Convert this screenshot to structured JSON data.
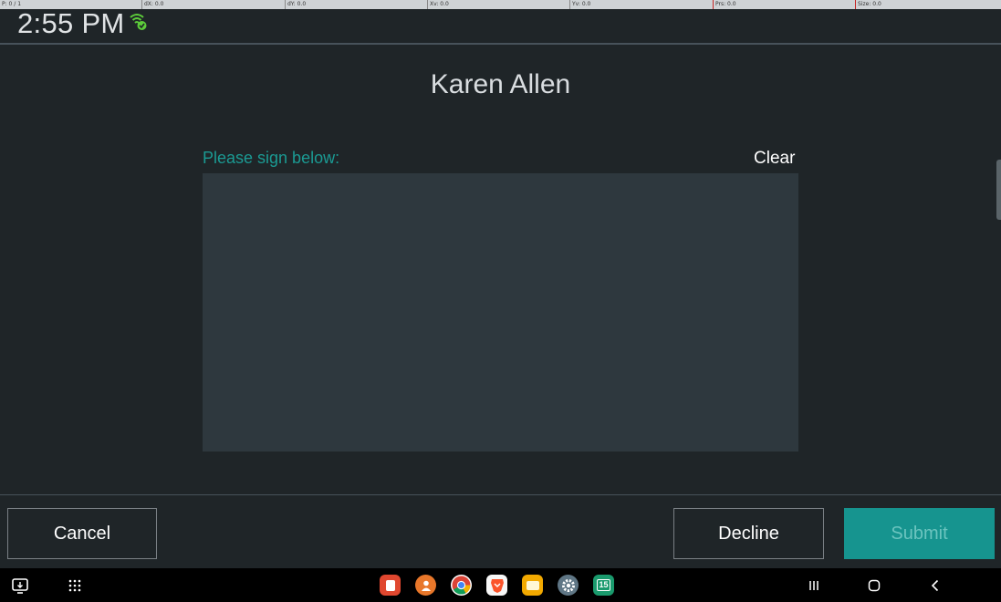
{
  "debug_bar": {
    "pointer": "P: 0 / 1",
    "dx": "dX: 0.0",
    "dy": "dY: 0.0",
    "xv": "Xv: 0.0",
    "yv": "Yv: 0.0",
    "prs": "Prs: 0.0",
    "size": "Size: 0.0"
  },
  "status_bar": {
    "time": "2:55 PM",
    "wifi_icon": "wifi-connected-icon"
  },
  "signer": {
    "name": "Karen Allen"
  },
  "signature": {
    "prompt": "Please sign below:",
    "clear_label": "Clear"
  },
  "actions": {
    "cancel_label": "Cancel",
    "decline_label": "Decline",
    "submit_label": "Submit"
  },
  "nav": {
    "apps": [
      "taskbar-app-red-icon",
      "contacts-icon",
      "chrome-icon",
      "brave-icon",
      "files-icon",
      "settings-icon",
      "calendar-icon"
    ],
    "calendar_day": "15"
  },
  "colors": {
    "accent": "#1b9a93",
    "submit_bg": "#16948f",
    "background": "#1f2528",
    "pad": "#2e383e"
  }
}
